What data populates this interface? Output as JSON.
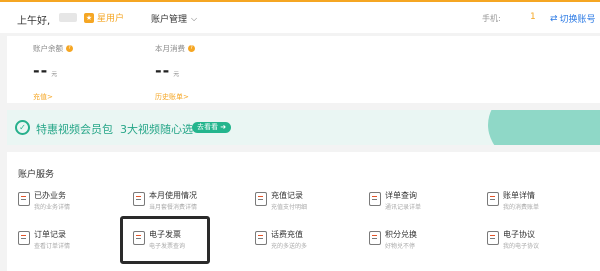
{
  "header": {
    "greeting": "上午好,",
    "member_label": "星用户",
    "account_mgmt": "账户管理",
    "phone_label": "手机:",
    "phone_value": "1",
    "switch_account": "切换账号"
  },
  "balance": {
    "account_balance_label": "账户余额",
    "account_balance_value": "--",
    "account_balance_unit": "元",
    "recharge_link": "充值>",
    "monthly_spend_label": "本月消费",
    "monthly_spend_value": "--",
    "monthly_spend_unit": "元",
    "history_bill_link": "历史账单>"
  },
  "promo": {
    "title": "特惠视频会员包",
    "subtitle": "3大视频随心选",
    "button": "去看看"
  },
  "services": {
    "heading": "账户服务",
    "items": [
      {
        "name": "已办业务",
        "desc": "我的业务详情",
        "icon": "briefcase-icon"
      },
      {
        "name": "本月使用情况",
        "desc": "当月套餐消费详情",
        "icon": "usage-icon"
      },
      {
        "name": "充值记录",
        "desc": "充值支付明细",
        "icon": "recharge-record-icon"
      },
      {
        "name": "详单查询",
        "desc": "通讯记录详单",
        "icon": "detail-query-icon"
      },
      {
        "name": "账单详情",
        "desc": "我的消费账单",
        "icon": "bill-icon"
      },
      {
        "name": "订单记录",
        "desc": "查看订单详情",
        "icon": "order-icon"
      },
      {
        "name": "电子发票",
        "desc": "电子发票查询",
        "icon": "invoice-icon"
      },
      {
        "name": "话费充值",
        "desc": "充的多送的多",
        "icon": "phone-recharge-icon"
      },
      {
        "name": "积分兑换",
        "desc": "好物兑不停",
        "icon": "gift-icon"
      },
      {
        "name": "电子协议",
        "desc": "我的电子协议",
        "icon": "contract-icon"
      }
    ]
  },
  "colors": {
    "accent": "#f5a623",
    "link_blue": "#2d7be5",
    "promo_green": "#26a688"
  }
}
